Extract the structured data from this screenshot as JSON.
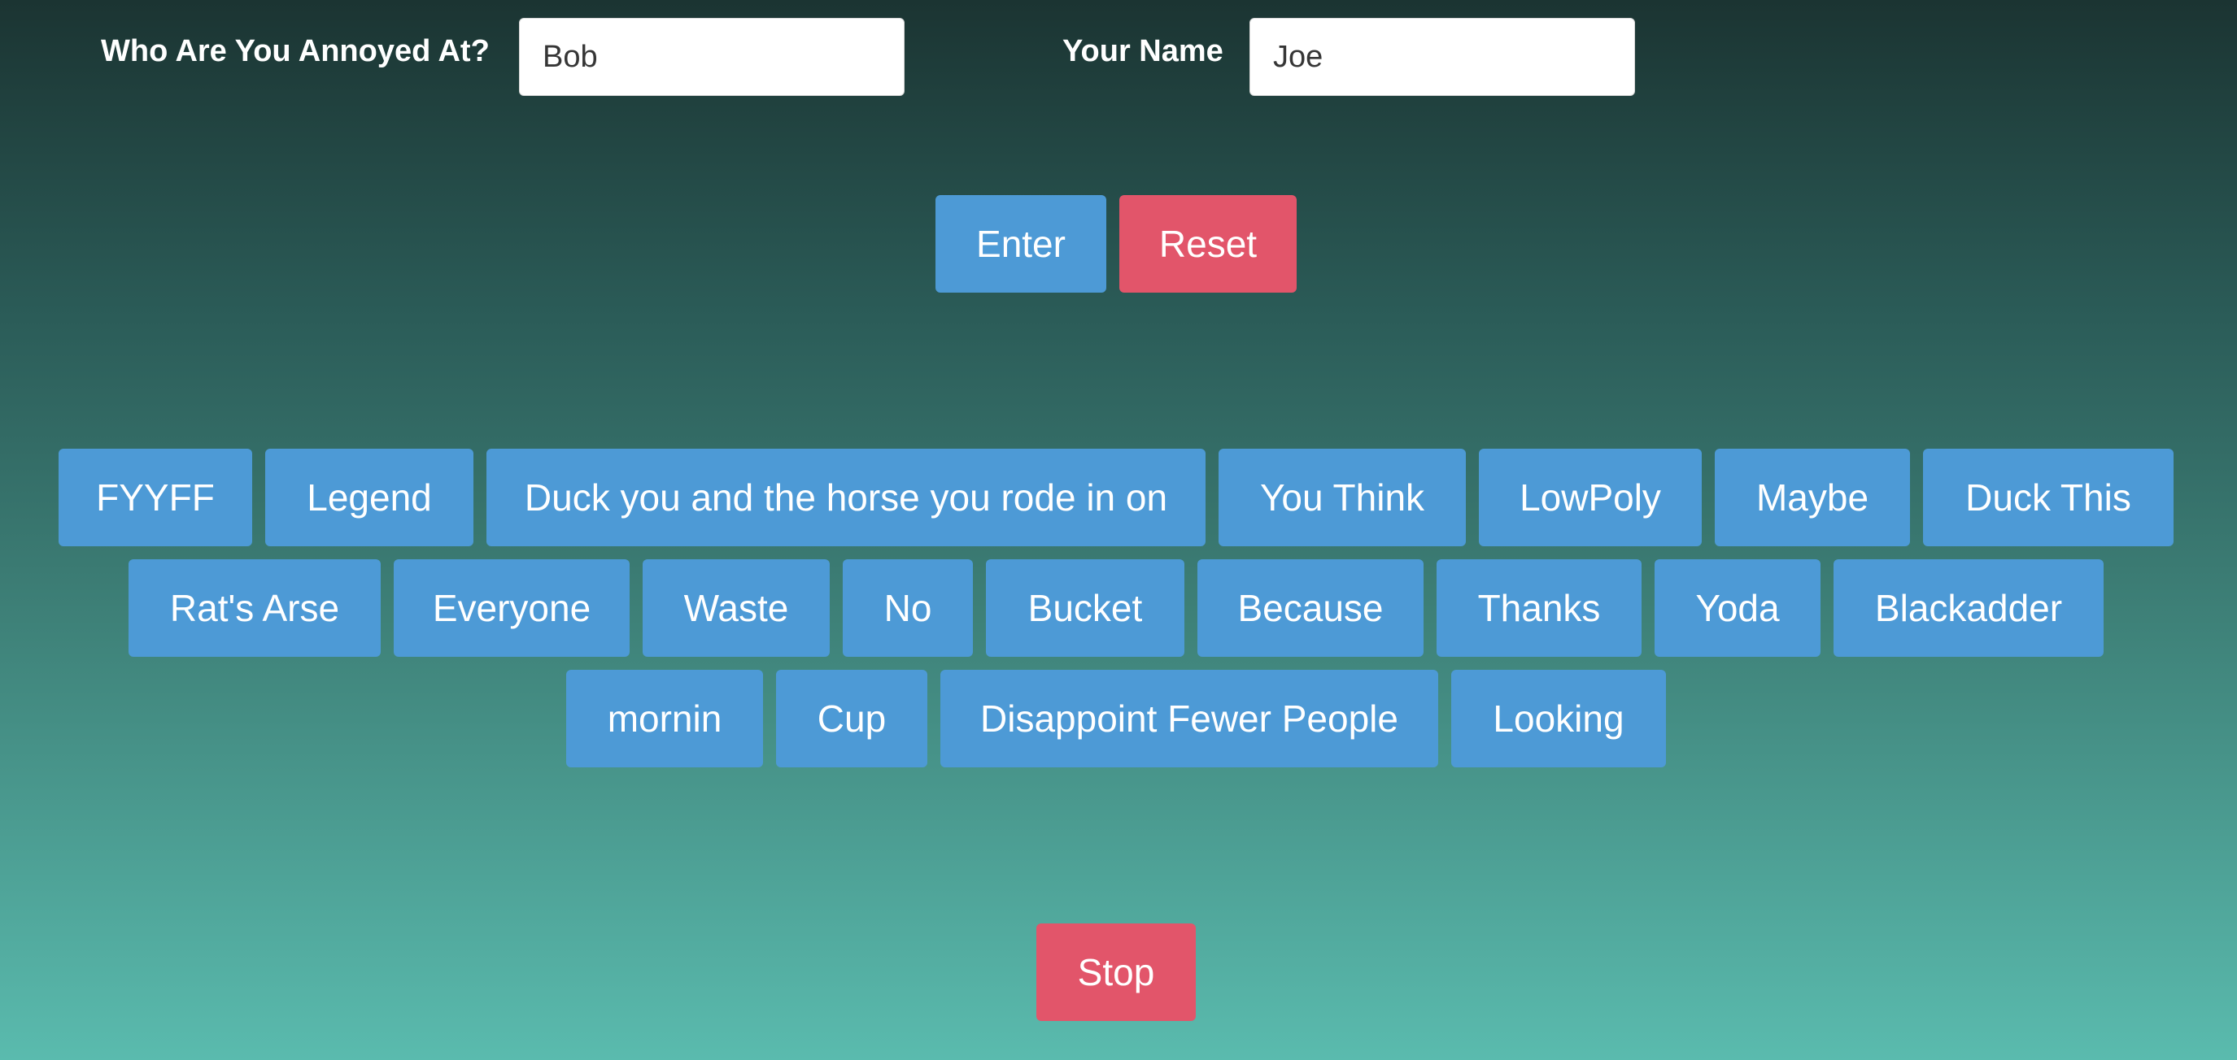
{
  "form": {
    "annoyed_label": "Who Are You Annoyed At?",
    "annoyed_value": "Bob",
    "name_label": "Your Name",
    "name_value": "Joe"
  },
  "actions": {
    "enter_label": "Enter",
    "reset_label": "Reset",
    "stop_label": "Stop"
  },
  "phrases": {
    "row1": [
      "FYYFF",
      "Legend",
      "Duck you and the horse you rode in on",
      "You Think",
      "LowPoly",
      "Maybe",
      "Duck This"
    ],
    "row2": [
      "Rat's Arse",
      "Everyone",
      "Waste",
      "No",
      "Bucket",
      "Because",
      "Thanks",
      "Yoda",
      "Blackadder"
    ],
    "row3": [
      "mornin",
      "Cup",
      "Disappoint Fewer People",
      "Looking"
    ]
  },
  "colors": {
    "primary_button": "#4d9ad6",
    "danger_button": "#e2556a",
    "background_top": "#1b3432",
    "background_bottom": "#5abbae"
  }
}
